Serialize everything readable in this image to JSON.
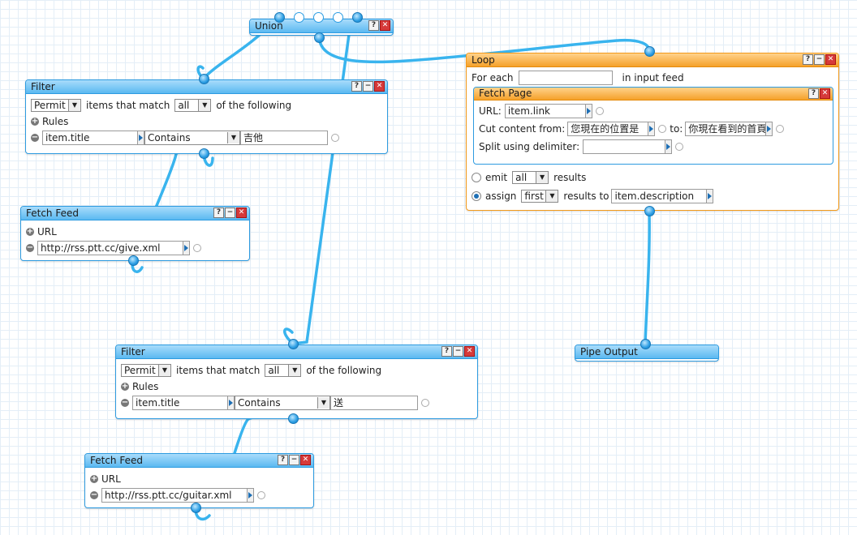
{
  "colors": {
    "wire": "#39b4ee",
    "module_border": "#2d9be0",
    "loop_border": "#f39a1b"
  },
  "buttons": {
    "help": "?",
    "minimize": "−",
    "close": "✕"
  },
  "union": {
    "title": "Union"
  },
  "filter1": {
    "title": "Filter",
    "mode": "Permit",
    "match_prefix": "items that match",
    "match": "all",
    "match_suffix": "of the following",
    "rules_label": "Rules",
    "rule_field": "item.title",
    "rule_op": "Contains",
    "rule_value": "吉他"
  },
  "fetch1": {
    "title": "Fetch Feed",
    "url_label": "URL",
    "url": "http://rss.ptt.cc/give.xml"
  },
  "filter2": {
    "title": "Filter",
    "mode": "Permit",
    "match_prefix": "items that match",
    "match": "all",
    "match_suffix": "of the following",
    "rules_label": "Rules",
    "rule_field": "item.title",
    "rule_op": "Contains",
    "rule_value": "送"
  },
  "fetch2": {
    "title": "Fetch Feed",
    "url_label": "URL",
    "url": "http://rss.ptt.cc/guitar.xml"
  },
  "loop": {
    "title": "Loop",
    "for_each": "For each",
    "in_input_feed": "in input feed",
    "emit_label": "emit",
    "emit_value": "all",
    "emit_suffix": "results",
    "assign_label": "assign",
    "assign_value": "first",
    "assign_mid": "results to",
    "assign_target": "item.description"
  },
  "fetch_page": {
    "title": "Fetch Page",
    "url_label": "URL:",
    "url": "item.link",
    "cut_label": "Cut content from:",
    "cut_from": "您現在的位置是",
    "to_label": "to:",
    "cut_to": "你現在看到的首頁",
    "split_label": "Split using delimiter:",
    "split_value": ""
  },
  "pipe_output": {
    "title": "Pipe Output"
  }
}
